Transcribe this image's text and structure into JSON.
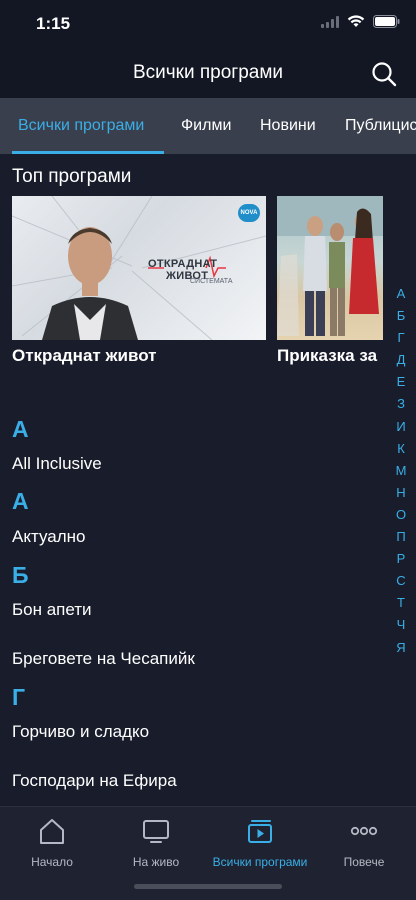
{
  "status_bar": {
    "time": "1:15"
  },
  "header": {
    "title": "Всички програми"
  },
  "tabs": [
    {
      "label": "Всички програми",
      "active": true
    },
    {
      "label": "Филми",
      "active": false
    },
    {
      "label": "Новини",
      "active": false
    },
    {
      "label": "Публицис",
      "active": false
    }
  ],
  "top_section": {
    "title": "Топ програми",
    "cards": [
      {
        "title": "Откраднат живот",
        "poster_logo_line1": "ОТКРАДНАТ",
        "poster_logo_line2": "ЖИВОТ",
        "poster_logo_sub": "СИСТЕМАТА",
        "channel_badge": "NOVA"
      },
      {
        "title": "Приказка за"
      }
    ]
  },
  "programs": [
    {
      "type": "letter",
      "text": "А"
    },
    {
      "type": "item",
      "text": "All Inclusive"
    },
    {
      "type": "letter",
      "text": "А"
    },
    {
      "type": "item",
      "text": "Актуално"
    },
    {
      "type": "letter",
      "text": "Б"
    },
    {
      "type": "item",
      "text": "Бон апети"
    },
    {
      "type": "item",
      "text": "Бреговете на Чесапийк"
    },
    {
      "type": "letter",
      "text": "Г"
    },
    {
      "type": "item",
      "text": "Горчиво и сладко"
    },
    {
      "type": "item",
      "text": "Господари на Ефира"
    }
  ],
  "alpha_index": [
    "А",
    "Б",
    "Г",
    "Д",
    "Е",
    "З",
    "И",
    "К",
    "М",
    "Н",
    "О",
    "П",
    "Р",
    "С",
    "Т",
    "Ч",
    "Я"
  ],
  "tabbar": [
    {
      "label": "Начало",
      "icon": "home-icon",
      "active": false
    },
    {
      "label": "На живо",
      "icon": "tv-icon",
      "active": false
    },
    {
      "label": "Всички програми",
      "icon": "play-stack-icon",
      "active": true
    },
    {
      "label": "Повече",
      "icon": "more-dots-icon",
      "active": false
    }
  ],
  "colors": {
    "accent": "#3aaee6",
    "background": "#191d2b",
    "tab_strip": "#3a3f4d"
  }
}
